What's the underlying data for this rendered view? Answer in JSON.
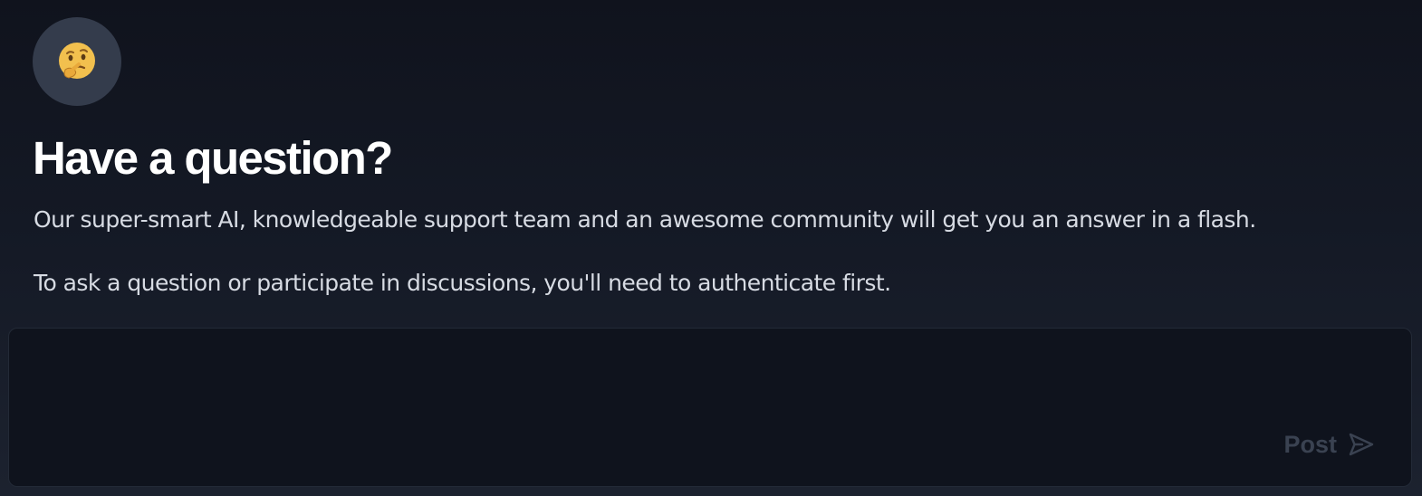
{
  "avatar": {
    "icon": "thinking-face-icon",
    "bg_color": "#343c4c"
  },
  "heading": {
    "title": "Have a question?"
  },
  "intro": {
    "line1": "Our super-smart AI, knowledgeable support team and an awesome community will get you an answer in a flash.",
    "line2": "To ask a question or participate in discussions, you'll need to authenticate first."
  },
  "composer": {
    "value": "",
    "post_label": "Post",
    "post_icon": "send-icon",
    "post_color": "#3a4251"
  }
}
